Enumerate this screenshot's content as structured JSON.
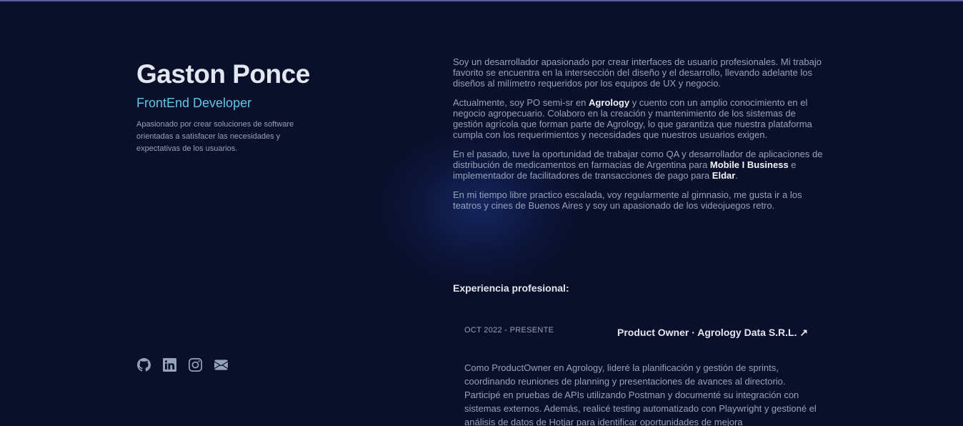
{
  "profile": {
    "name": "Gaston Ponce",
    "role": "FrontEnd Developer",
    "tagline": "Apasionado por crear soluciones de software orientadas a satisfacer las necesidades y expectativas de los usuarios."
  },
  "socials": [
    {
      "icon": "github-icon"
    },
    {
      "icon": "linkedin-icon"
    },
    {
      "icon": "instagram-icon"
    },
    {
      "icon": "mail-icon"
    }
  ],
  "about": {
    "p1": "Soy un desarrollador apasionado por crear interfaces de usuario profesionales. Mi trabajo favorito se encuentra en la intersección del diseño y el desarrollo, llevando adelante los diseños al milímetro requeridos por los equipos de UX y negocio.",
    "p2_a": "Actualmente, soy PO semi-sr en ",
    "p2_company": "Agrology",
    "p2_b": " y cuento con un amplio conocimiento en el negocio agropecuario. Colaboro en la creación y mantenimiento de los sistemas de gestión agrícola que forman parte de Agrology, lo que garantiza que nuestra plataforma cumpla con los requerimientos y necesidades que nuestros usuarios exigen.",
    "p3_a": "En el pasado, tuve la oportunidad de trabajar como QA y desarrollador de aplicaciones de distribución de medicamentos en farmacias de Argentina para ",
    "p3_company1": "Mobile I Business",
    "p3_b": " e implementador de facilitadores de transacciones de pago para ",
    "p3_company2": "Eldar",
    "p3_c": ".",
    "p4": "En mi tiempo libre practico escalada, voy regularmente al gimnasio, me gusta ir a los teatros y cines de Buenos Aires y soy un apasionado de los videojuegos retro."
  },
  "experience": {
    "heading": "Experiencia profesional:",
    "job": {
      "date": "OCT 2022 - PRESENTE",
      "title": "Product Owner · Agrology Data S.R.L. ↗",
      "description": "Como ProductOwner en Agrology, lideré la planificación y gestión de sprints, coordinando reuniones de planning y presentaciones de avances al directorio. Participé en pruebas de APIs utilizando Postman y documenté su integración con sistemas externos. Además, realicé testing automatizado con Playwright y gestioné el análisis de datos de Hotjar para identificar oportunidades de mejora"
    }
  },
  "colors": {
    "background": "#0a0f2a",
    "accent": "#5ec8e8",
    "heading": "#e2e8f0",
    "text": "#94a3b8"
  }
}
